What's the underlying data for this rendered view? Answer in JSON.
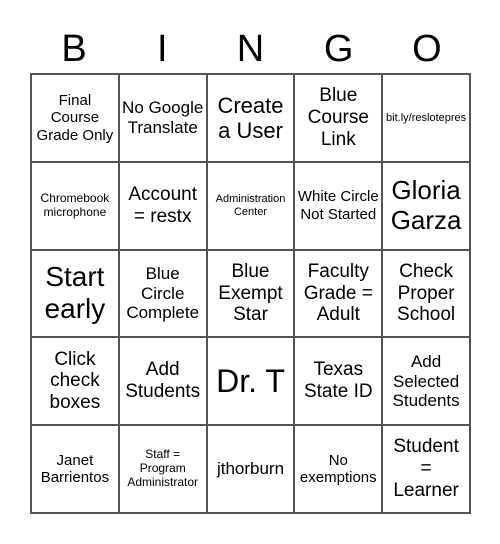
{
  "header": [
    "B",
    "I",
    "N",
    "G",
    "O"
  ],
  "cells": [
    "Final Course Grade Only",
    "No Google Translate",
    "Create a User",
    "Blue Course Link",
    "bit.ly/reslotepres",
    "Chromebook microphone",
    "Account = restx",
    "Administration Center",
    "White Circle Not Started",
    "Gloria Garza",
    "Start early",
    "Blue Circle Complete",
    "Blue Exempt Star",
    "Faculty Grade = Adult",
    "Check Proper School",
    "Click check boxes",
    "Add Students",
    "Dr. T",
    "Texas State ID",
    "Add Selected Students",
    "Janet Barrientos",
    "Staff = Program Administrator",
    "jthorburn",
    "No exemptions",
    "Student = Learner"
  ]
}
